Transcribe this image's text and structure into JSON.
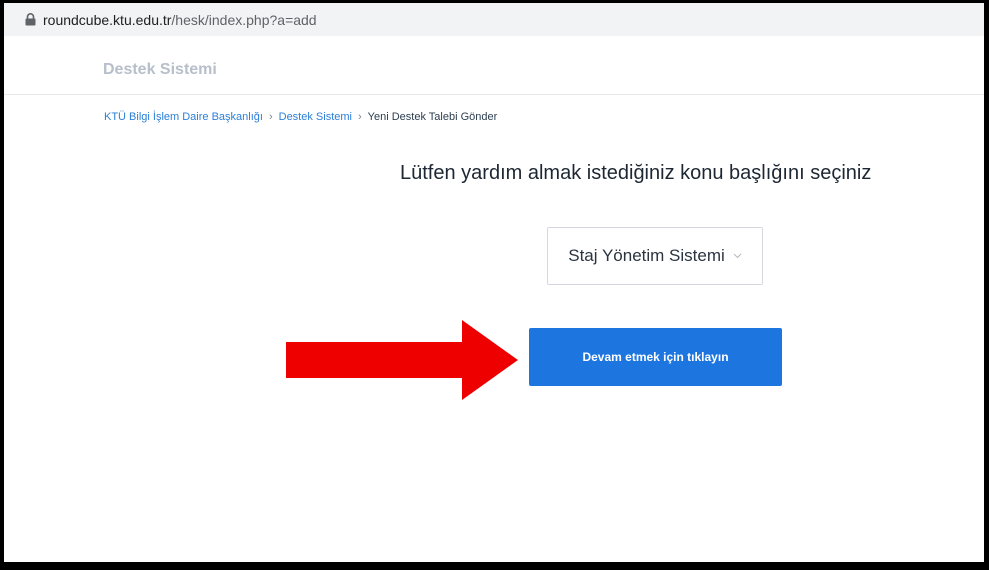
{
  "browser": {
    "url_host": "roundcube.ktu.edu.tr",
    "url_path": "/hesk/index.php?a=add"
  },
  "header": {
    "brand": "Destek Sistemi"
  },
  "breadcrumb": {
    "items": [
      "KTÜ Bilgi İşlem Daire Başkanlığı",
      "Destek Sistemi"
    ],
    "current": "Yeni Destek Talebi Gönder",
    "separator": "›"
  },
  "main": {
    "title": "Lütfen yardım almak istediğiniz konu başlığını seçiniz",
    "category_select": {
      "selected": "Staj Yönetim Sistemi"
    },
    "continue_button": "Devam etmek için tıklayın"
  },
  "colors": {
    "accent": "#1d76e0",
    "arrow": "#ee0000",
    "link": "#2b7fd6"
  }
}
